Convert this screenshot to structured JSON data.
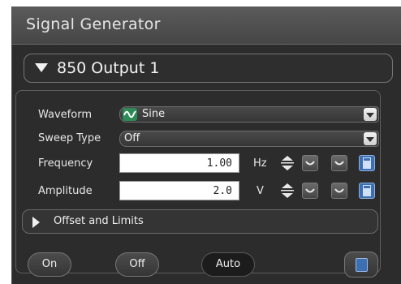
{
  "header": {
    "title": "Signal Generator"
  },
  "group": {
    "label": "850 Output 1"
  },
  "waveform": {
    "label": "Waveform",
    "value": "Sine"
  },
  "sweep": {
    "label": "Sweep Type",
    "value": "Off"
  },
  "frequency": {
    "label": "Frequency",
    "value": "1.00",
    "unit": "Hz"
  },
  "amplitude": {
    "label": "Amplitude",
    "value": "2.0",
    "unit": "V"
  },
  "offset": {
    "label": "Offset and Limits"
  },
  "buttons": {
    "on": "On",
    "off": "Off",
    "auto": "Auto"
  },
  "icons": {
    "waveform": "sine-wave-icon",
    "spin": "up-down-spinner-icon",
    "decrease": "decrease-tilde-icon",
    "increase": "increase-tilde-icon",
    "calculator": "calculator-icon"
  },
  "colors": {
    "accent_green": "#2e8b57",
    "calc_blue": "#3d6fb3",
    "panel": "#2c2c2c"
  }
}
